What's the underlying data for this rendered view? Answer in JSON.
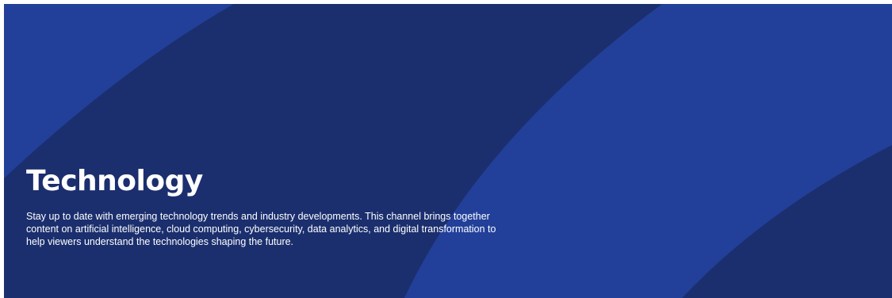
{
  "channel": {
    "title": "Technology",
    "description": "Stay up to date with emerging technology trends and industry developments. This channel brings together content on artificial intelligence, cloud computing, cybersecurity, data analytics, and digital transformation to help viewers understand the technologies shaping the future."
  },
  "colors": {
    "background_dark": "#1b2f6e",
    "background_light": "#22409a",
    "text": "#ffffff"
  }
}
